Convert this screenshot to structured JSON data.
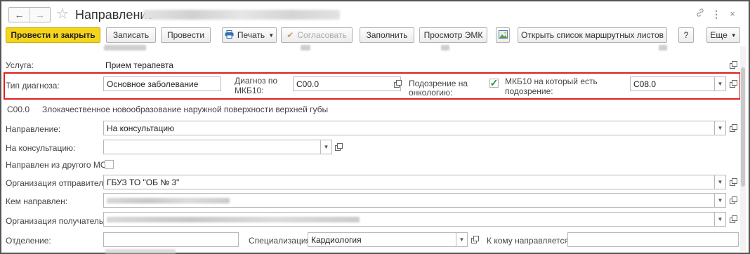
{
  "window": {
    "title": "Направление"
  },
  "toolbar": {
    "post_close": "Провести и закрыть",
    "save": "Записать",
    "post": "Провести",
    "print": "Печать",
    "approve": "Согласовать",
    "fill": "Заполнить",
    "emk": "Просмотр ЭМК",
    "route_lists": "Открыть список маршрутных листов",
    "help": "?",
    "more": "Еще"
  },
  "form": {
    "service_label": "Услуга:",
    "service_value": "Прием терапевта",
    "diag_type_label": "Тип диагноза:",
    "diag_type_value": "Основное заболевание",
    "mkb_label_1": "Диагноз по",
    "mkb_label_2": "МКБ10:",
    "mkb_value": "C00.0",
    "onco_label_1": "Подозрение на",
    "onco_label_2": "онкологию:",
    "onco_checked": true,
    "mkb_susp_label_1": "МКБ10 на который есть",
    "mkb_susp_label_2": "подозрение:",
    "mkb_susp_value": "C08.0",
    "diag_code": "C00.0",
    "diag_desc": "Злокачественное новообразование наружной поверхности верхней губы",
    "direction_label": "Направление:",
    "direction_value": "На консультацию",
    "consult_label": "На консультацию:",
    "consult_value": "",
    "other_mo_label": "Направлен из другого МО:",
    "other_mo_checked": false,
    "sender_org_label": "Организация отправитель:",
    "sender_org_value": "ГБУЗ ТО \"ОБ № 3\"",
    "sent_by_label": "Кем направлен:",
    "receiver_org_label": "Организация получатель:",
    "department_label": "Отделение:",
    "department_value": "",
    "specialization_label": "Специализация:",
    "specialization_value": "Кардиология",
    "to_whom_label": "К кому направляется:",
    "to_whom_value": ""
  },
  "colors": {
    "primary_button": "#f4d51c",
    "highlight_border": "#e02020",
    "check": "#1f8f3a"
  },
  "icons": [
    "back-arrow-icon",
    "forward-arrow-icon",
    "star-icon",
    "link-icon",
    "menu-dots-icon",
    "close-icon",
    "printer-icon",
    "approve-icon",
    "picture-icon",
    "open-form-icon",
    "dropdown-arrow-icon"
  ]
}
